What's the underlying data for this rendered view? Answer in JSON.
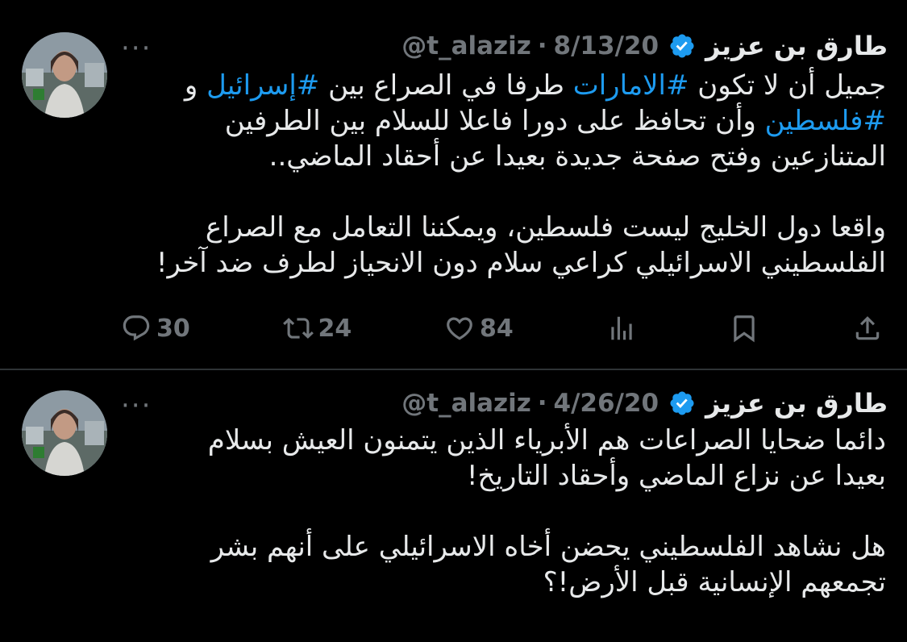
{
  "tweets": [
    {
      "author": {
        "name": "طارق بن عزيز",
        "handle": "@t_alaziz",
        "separator": "·",
        "date": "8/13/20"
      },
      "more_label": "···",
      "lines": {
        "l1_a": "جميل أن لا تكون ",
        "l1_tag1": "#الامارات",
        "l1_b": " طرفا في الصراع بين ",
        "l1_tag2": "#إسرائيل",
        "l1_c": " و",
        "l2_tag": "#فلسطين",
        "l2_a": " وأن تحافظ على دورا فاعلا للسلام بين الطرفين",
        "l3": "المتنازعين وفتح صفحة جديدة بعيدا عن أحقاد الماضي..",
        "l4": "واقعا دول الخليج ليست فلسطين، ويمكننا التعامل مع الصراع",
        "l5": "الفلسطيني الاسرائيلي كراعي سلام دون الانحياز لطرف ضد آخر!"
      },
      "actions": {
        "replies": "30",
        "retweets": "24",
        "likes": "84"
      }
    },
    {
      "author": {
        "name": "طارق بن عزيز",
        "handle": "@t_alaziz",
        "separator": "·",
        "date": "4/26/20"
      },
      "more_label": "···",
      "lines": {
        "l1": "دائما ضحايا الصراعات هم الأبرياء الذين يتمنون العيش بسلام",
        "l2": "بعيدا عن نزاع الماضي وأحقاد التاريخ!",
        "l3": "هل نشاهد الفلسطيني يحضن أخاه الاسرائيلي على أنهم بشر",
        "l4": "تجمعهم الإنسانية قبل الأرض!؟"
      }
    }
  ],
  "colors": {
    "background": "#000000",
    "text": "#e7e9ea",
    "muted": "#71767b",
    "hashtag": "#1d9bf0",
    "verified": "#1d9bf0",
    "divider": "#2f3336"
  },
  "icons": [
    "reply-icon",
    "retweet-icon",
    "like-icon",
    "analytics-icon",
    "bookmark-icon",
    "share-icon",
    "verified-badge-icon",
    "more-icon"
  ]
}
